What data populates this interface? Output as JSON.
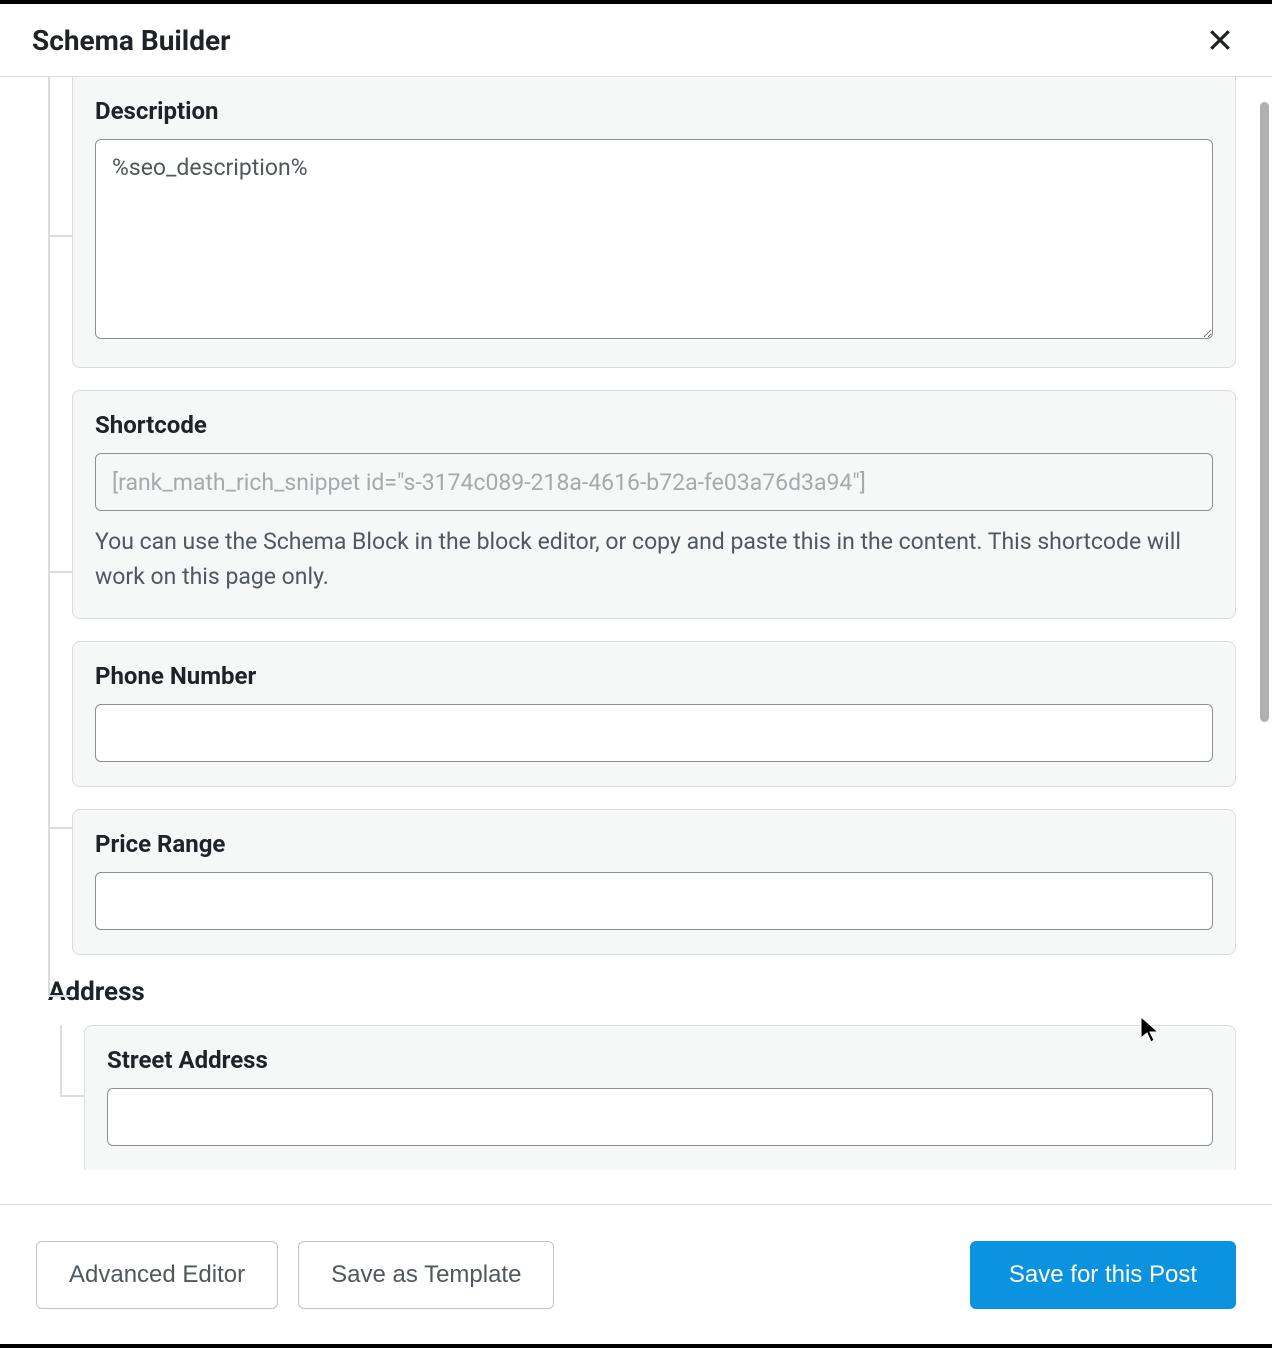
{
  "header": {
    "title": "Schema Builder"
  },
  "fields": {
    "description": {
      "label": "Description",
      "value": "%seo_description%"
    },
    "shortcode": {
      "label": "Shortcode",
      "value": "[rank_math_rich_snippet id=\"s-3174c089-218a-4616-b72a-fe03a76d3a94\"]",
      "help": "You can use the Schema Block in the block editor, or copy and paste this in the content. This shortcode will work on this page only."
    },
    "phone": {
      "label": "Phone Number",
      "value": ""
    },
    "price_range": {
      "label": "Price Range",
      "value": ""
    },
    "address": {
      "label": "Address",
      "street": {
        "label": "Street Address",
        "value": ""
      }
    }
  },
  "footer": {
    "advanced_editor": "Advanced Editor",
    "save_template": "Save as Template",
    "save_post": "Save for this Post"
  }
}
